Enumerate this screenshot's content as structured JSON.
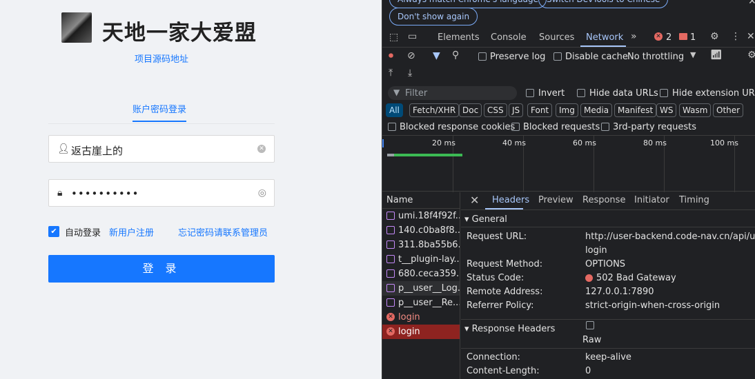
{
  "login": {
    "title": "天地一家大爱盟",
    "source_link": "项目源码地址",
    "tab_account": "账户密码登录",
    "username_value": "返古崖上的",
    "password_value": "••••••••••",
    "auto_login_label": "自动登录",
    "new_user_link": "新用户注册",
    "forgot_link": "忘记密码请联系管理员",
    "login_button": "登 录",
    "colors": {
      "primary": "#1677ff",
      "background": "#f0f2f5"
    }
  },
  "devtools": {
    "pills": [
      "Always match Chrome's language",
      "Switch DevTools to Chinese",
      "Don't show again"
    ],
    "tabs": [
      "Elements",
      "Console",
      "Sources",
      "Network"
    ],
    "active_tab": "Network",
    "error_count": "2",
    "warning_count": "1",
    "toolbar": {
      "preserve_log": "Preserve log",
      "disable_cache": "Disable cache",
      "throttling": "No throttling"
    },
    "filter": {
      "placeholder": "Filter",
      "invert": "Invert",
      "hide_data_urls": "Hide data URLs",
      "hide_extension_urls": "Hide extension URLs"
    },
    "type_filters": [
      "All",
      "Fetch/XHR",
      "Doc",
      "CSS",
      "JS",
      "Font",
      "Img",
      "Media",
      "Manifest",
      "WS",
      "Wasm",
      "Other"
    ],
    "blocked": {
      "blocked_cookies": "Blocked response cookies",
      "blocked_requests": "Blocked requests",
      "third_party": "3rd-party requests"
    },
    "timeline_ticks": [
      "20 ms",
      "40 ms",
      "60 ms",
      "80 ms",
      "100 ms"
    ],
    "name_header": "Name",
    "requests": [
      {
        "name": "umi.18f4f92f...",
        "status": "ok"
      },
      {
        "name": "140.c0ba8f8...",
        "status": "ok"
      },
      {
        "name": "311.8ba55b6...",
        "status": "ok"
      },
      {
        "name": "t__plugin-lay...",
        "status": "ok"
      },
      {
        "name": "680.ceca359...",
        "status": "ok"
      },
      {
        "name": "p__user__Log...",
        "status": "ok"
      },
      {
        "name": "p__user__Re...",
        "status": "ok"
      },
      {
        "name": "login",
        "status": "error"
      },
      {
        "name": "login",
        "status": "error-selected"
      }
    ],
    "detail_tabs": [
      "Headers",
      "Preview",
      "Response",
      "Initiator",
      "Timing"
    ],
    "general": {
      "title": "General",
      "request_url_key": "Request URL:",
      "request_url_line1": "http://user-backend.code-nav.cn/api/user/",
      "request_url_line2": "login",
      "request_method_key": "Request Method:",
      "request_method": "OPTIONS",
      "status_code_key": "Status Code:",
      "status_code": "502 Bad Gateway",
      "remote_address_key": "Remote Address:",
      "remote_address": "127.0.0.1:7890",
      "referrer_policy_key": "Referrer Policy:",
      "referrer_policy": "strict-origin-when-cross-origin"
    },
    "response_headers": {
      "title": "Response Headers",
      "raw_label": "Raw",
      "connection_key": "Connection:",
      "connection": "keep-alive",
      "content_length_key": "Content-Length:",
      "content_length": "0"
    }
  }
}
